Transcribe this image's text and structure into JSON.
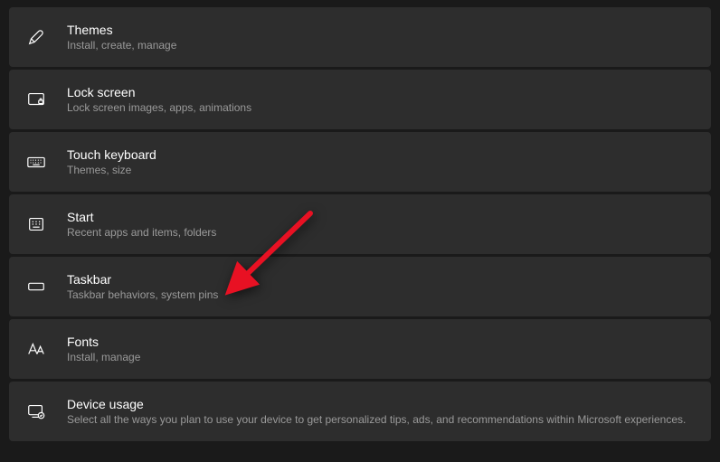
{
  "settings": [
    {
      "id": "themes",
      "title": "Themes",
      "description": "Install, create, manage"
    },
    {
      "id": "lock-screen",
      "title": "Lock screen",
      "description": "Lock screen images, apps, animations"
    },
    {
      "id": "touch-keyboard",
      "title": "Touch keyboard",
      "description": "Themes, size"
    },
    {
      "id": "start",
      "title": "Start",
      "description": "Recent apps and items, folders"
    },
    {
      "id": "taskbar",
      "title": "Taskbar",
      "description": "Taskbar behaviors, system pins"
    },
    {
      "id": "fonts",
      "title": "Fonts",
      "description": "Install, manage"
    },
    {
      "id": "device-usage",
      "title": "Device usage",
      "description": "Select all the ways you plan to use your device to get personalized tips, ads, and recommendations within Microsoft experiences."
    }
  ]
}
